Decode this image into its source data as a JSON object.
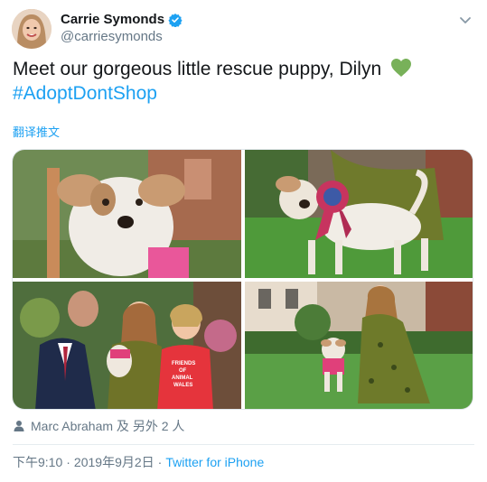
{
  "author": {
    "display_name": "Carrie Symonds",
    "handle": "@carriesymonds",
    "verified": true,
    "verified_color": "#1da1f2"
  },
  "tweet": {
    "text": "Meet our gorgeous little rescue puppy, Dilyn",
    "emoji": "green-heart",
    "hashtag": "#AdoptDontShop",
    "translate_label": "翻译推文"
  },
  "media": {
    "photos": [
      {
        "name": "puppy-closeup"
      },
      {
        "name": "puppy-with-rosette"
      },
      {
        "name": "people-with-puppy"
      },
      {
        "name": "woman-with-puppy-on-lawn"
      }
    ],
    "photo3_shirt_text": [
      "FRIENDS",
      "OF",
      "ANIMAL",
      "WALES"
    ]
  },
  "tagged": {
    "text": "Marc Abraham 及 另外 2 人"
  },
  "meta": {
    "time": "下午9:10",
    "separator": "·",
    "date": "2019年9月2日",
    "source": "Twitter for iPhone"
  },
  "colors": {
    "accent": "#1da1f2",
    "text": "#14171a",
    "secondary": "#657786",
    "heart": "#78b159"
  }
}
